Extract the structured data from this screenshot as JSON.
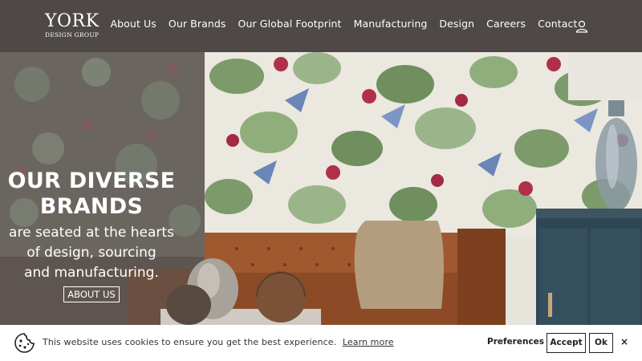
{
  "logo": {
    "main": "YORK",
    "sub": "DESIGN GROUP"
  },
  "nav": {
    "items": [
      "About Us",
      "Our Brands",
      "Our Global Footprint",
      "Manufacturing",
      "Design",
      "Careers",
      "Contact"
    ]
  },
  "account": {
    "icon": "user-icon"
  },
  "hero": {
    "title_line1": "OUR DIVERSE",
    "title_line2": "BRANDS",
    "sub_line1": "are seated at the hearts",
    "sub_line2": "of design, sourcing",
    "sub_line3": "and manufacturing.",
    "button_label": "ABOUT US"
  },
  "cookie": {
    "icon": "cookie-icon",
    "text": "This website uses cookies to ensure you get the best experience.",
    "link": "Learn more",
    "preferences": "Preferences",
    "accept": "Accept",
    "ok": "Ok",
    "close": "×"
  }
}
